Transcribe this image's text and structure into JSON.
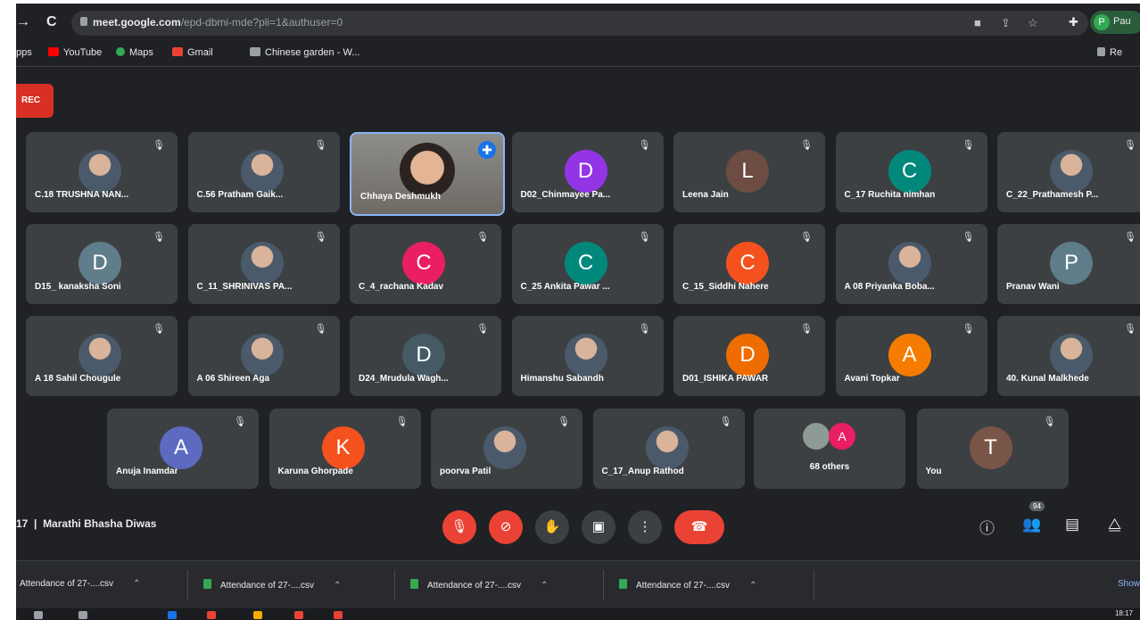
{
  "browser": {
    "back": "←",
    "forward": "→",
    "reload": "C",
    "url_host": "meet.google.com",
    "url_path": "/epd-dbmi-mde?pli=1&authuser=0",
    "profile_label": "Pau",
    "profile_initial": "P"
  },
  "bookmarks": [
    {
      "label": "pps",
      "color": "#4285f4"
    },
    {
      "label": "YouTube",
      "color": "#ff0000"
    },
    {
      "label": "Maps",
      "color": "#34a853"
    },
    {
      "label": "Gmail",
      "color": "#ea4335"
    },
    {
      "label": "Chinese garden - W...",
      "color": "#9aa0a6"
    }
  ],
  "bookmarks_right": "Re",
  "meet": {
    "rec_label": "REC",
    "participants": [
      {
        "name": "C.18 TRUSHNA NAN...",
        "type": "photo"
      },
      {
        "name": "C.56 Pratham Gaik...",
        "type": "photo"
      },
      {
        "name": "Chhaya Deshmukh",
        "type": "video"
      },
      {
        "name": "D02_Chinmayee Pa...",
        "initial": "D",
        "color": "#9334e6"
      },
      {
        "name": "Leena Jain",
        "initial": "L",
        "color": "#6d4c41"
      },
      {
        "name": "C_17 Ruchita nimhan",
        "initial": "C",
        "color": "#00897b"
      },
      {
        "name": "C_22_Prathamesh P...",
        "type": "photo"
      },
      {
        "name": "D15_ kanaksha Soni",
        "initial": "D",
        "color": "#607d8b"
      },
      {
        "name": "C_11_SHRINIVAS PA...",
        "type": "photo"
      },
      {
        "name": "C_4_rachana Kadav",
        "initial": "C",
        "color": "#e91e63"
      },
      {
        "name": "C_25 Ankita Pawar ...",
        "initial": "C",
        "color": "#00897b"
      },
      {
        "name": "C_15_Siddhi Nahere",
        "initial": "C",
        "color": "#f4511e"
      },
      {
        "name": "A 08 Priyanka Boba...",
        "type": "photo"
      },
      {
        "name": "Pranav Wani",
        "initial": "P",
        "color": "#5f7c8a"
      },
      {
        "name": "A 18 Sahil Chougule",
        "type": "photo"
      },
      {
        "name": "A 06 Shireen Aga",
        "type": "photo"
      },
      {
        "name": "D24_Mrudula Wagh...",
        "initial": "D",
        "color": "#455a64"
      },
      {
        "name": "Himanshu Sabandh",
        "type": "photo"
      },
      {
        "name": "D01_ISHIKA PAWAR",
        "initial": "D",
        "color": "#ef6c00"
      },
      {
        "name": "Avani Topkar",
        "initial": "A",
        "color": "#f57c00"
      },
      {
        "name": "40. Kunal Malkhede",
        "type": "photo"
      },
      {
        "name": "Anuja Inamdar",
        "initial": "A",
        "color": "#5c6bc0"
      },
      {
        "name": "Karuna Ghorpade",
        "initial": "K",
        "color": "#f4511e"
      },
      {
        "name": "poorva Patil",
        "type": "photo"
      },
      {
        "name": "C_17_Anup Rathod",
        "type": "photo"
      },
      {
        "name": "You",
        "initial": "T",
        "color": "#795548"
      }
    ],
    "others": {
      "label": "68 others",
      "initial": "A"
    },
    "meeting_time": "17",
    "meeting_title": "Marathi Bhasha Diwas",
    "people_count": "94"
  },
  "downloads": {
    "items": [
      "Attendance of 27-....csv",
      "Attendance of 27-....csv",
      "Attendance of 27-....csv",
      "Attendance of 27-....csv"
    ],
    "show_all": "Show"
  },
  "taskbar": {
    "clock": "18:17"
  }
}
